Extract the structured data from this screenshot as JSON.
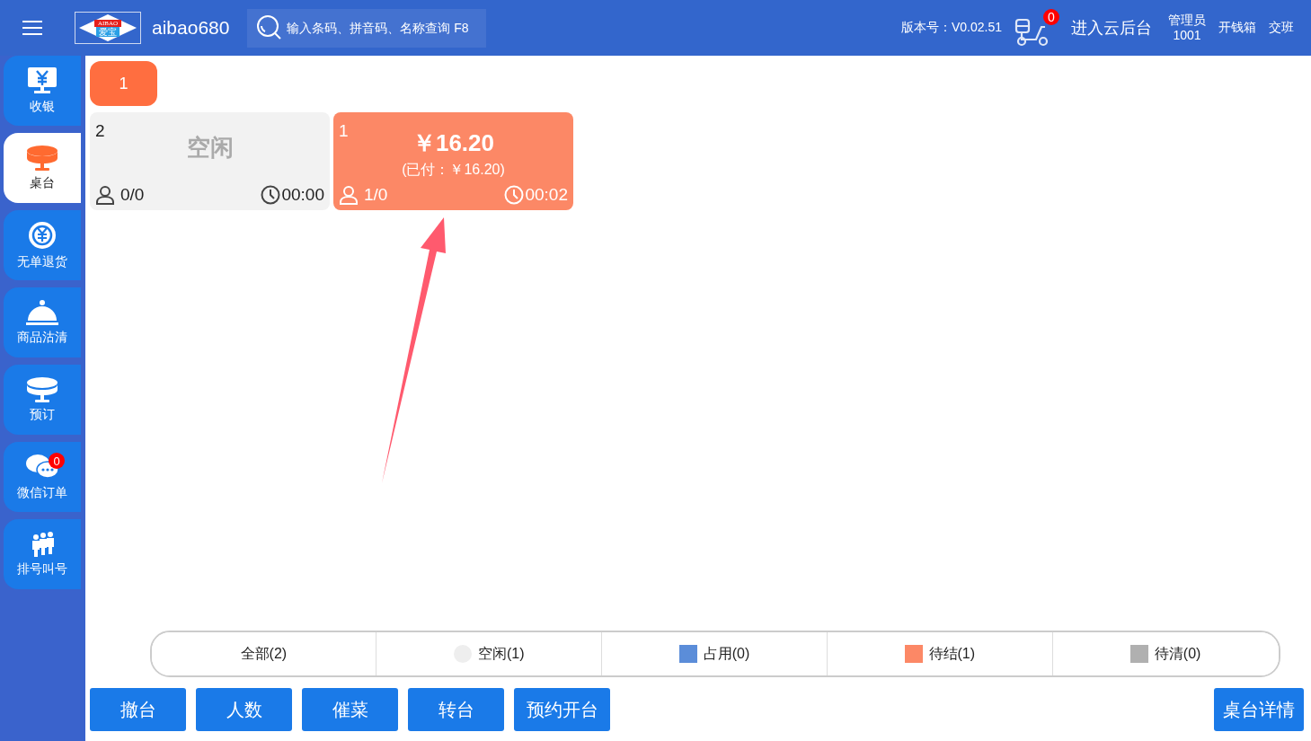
{
  "header": {
    "logo_text": "AIBAO",
    "logo_subtext": "爱宝",
    "store": "aibao680",
    "search": {
      "placeholder": "输入条码、拼音码、名称查询 F8"
    },
    "version": "版本号：V0.02.51",
    "delivery_badge": "0",
    "cloud_link": "进入云后台",
    "user_role": "管理员",
    "user_id": "1001",
    "actions": [
      "开钱箱",
      "交班"
    ]
  },
  "sidebar": {
    "items": [
      {
        "label": "收银",
        "kind": "cashier",
        "selected": false
      },
      {
        "label": "桌台",
        "kind": "table",
        "selected": true
      },
      {
        "label": "无单退货",
        "kind": "refund",
        "selected": false
      },
      {
        "label": "商品沽清",
        "kind": "cloche",
        "selected": false
      },
      {
        "label": "预订",
        "kind": "reserve",
        "selected": false
      },
      {
        "label": "微信订单",
        "kind": "chat",
        "selected": false,
        "badge": "0"
      },
      {
        "label": "排号叫号",
        "kind": "queue",
        "selected": false
      }
    ]
  },
  "areas": [
    {
      "label": "1",
      "selected": true
    }
  ],
  "tables": [
    {
      "number": "2",
      "kind": "idle",
      "status": "空闲",
      "guests": "0/0",
      "time": "00:00"
    },
    {
      "number": "1",
      "kind": "pending",
      "amount": "￥16.20",
      "paid": "(已付：￥16.20)",
      "guests": "1/0",
      "time": "00:02"
    }
  ],
  "filters": [
    {
      "label": "全部(2)",
      "selected": false
    },
    {
      "label": "空闲(1)",
      "color": "#eeeeee",
      "selected": false
    },
    {
      "label": "占用(0)",
      "color": "#5b8dd9",
      "selected": false
    },
    {
      "label": "待结(1)",
      "color": "#fc8866",
      "selected": false
    },
    {
      "label": "待清(0)",
      "color": "#b0b0b0",
      "selected": false
    }
  ],
  "actions": [
    "撤台",
    "人数",
    "催菜",
    "转台",
    "预约开台"
  ],
  "detail_button": "桌台详情"
}
